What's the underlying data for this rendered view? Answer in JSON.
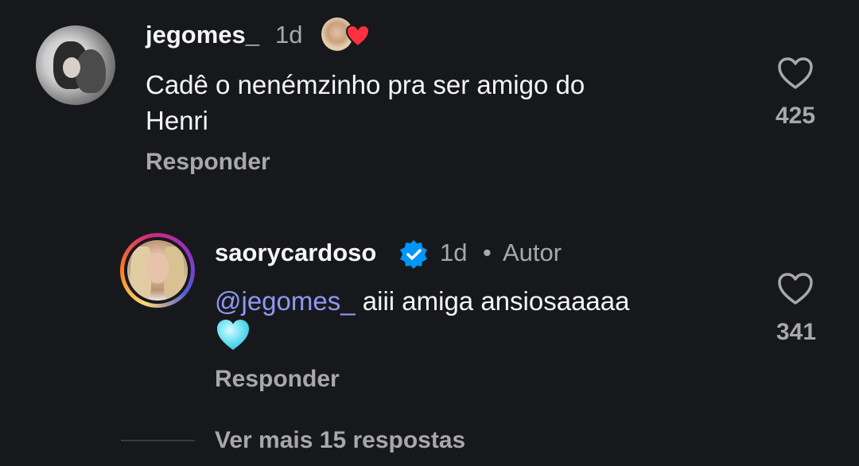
{
  "comments": [
    {
      "username": "jegomes_",
      "time": "1d",
      "text_line1": "Cadê o nenémzinho pra ser amigo do",
      "text_line2": "Henri",
      "reply_label": "Responder",
      "like_count": "425",
      "avatar_icon": "profile-photo",
      "liked_by_author": true
    },
    {
      "username": "saorycardoso",
      "verified": true,
      "time": "1d",
      "separator": "•",
      "author_badge": "Autor",
      "mention": "@jegomes_",
      "text": " aiii amiga ansiosaaaaa",
      "emoji": "light-blue-heart",
      "reply_label": "Responder",
      "like_count": "341"
    }
  ],
  "thread": {
    "see_more_label": "Ver mais 15 respostas"
  },
  "colors": {
    "background": "#17181c",
    "text_primary": "#f5f5f5",
    "text_secondary": "#a8a8a8",
    "mention": "#8e98f2",
    "verified": "#0095f6",
    "heart_red": "#ff3040",
    "emoji_heart": "#7fe6f5"
  }
}
